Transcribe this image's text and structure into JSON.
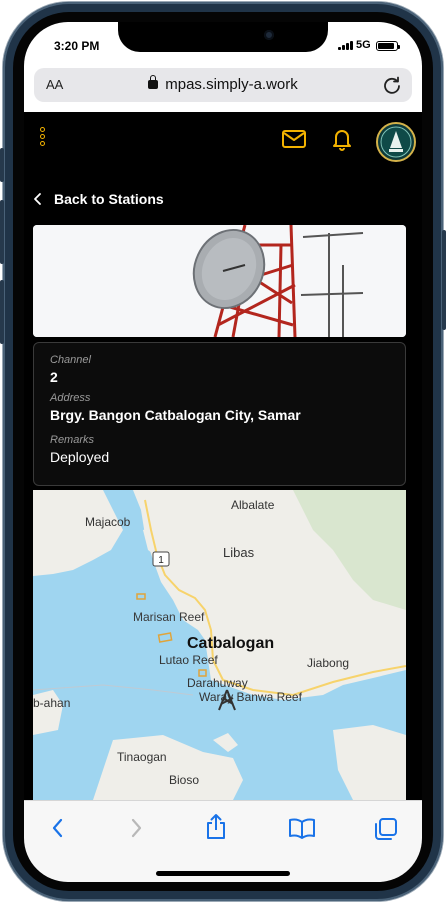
{
  "status_bar": {
    "time": "3:20 PM",
    "network": "5G",
    "battery_level": 0.9
  },
  "browser": {
    "text_size_label": "AA",
    "url": "mpas.simply-a.work",
    "reload_icon": "reload-icon",
    "toolbar": [
      "back-icon",
      "forward-icon",
      "share-icon",
      "bookmarks-icon",
      "tabs-icon"
    ]
  },
  "app_header": {
    "menu_icon": "kebab-menu-icon",
    "mail_icon": "mail-icon",
    "bell_icon": "bell-icon",
    "accent_color": "#f2b200"
  },
  "nav": {
    "back_label": "Back to Stations"
  },
  "station": {
    "channel_label": "Channel",
    "channel_value": "2",
    "address_label": "Address",
    "address_value": "Brgy. Bangon Catbalogan City, Samar",
    "remarks_label": "Remarks",
    "remarks_value": "Deployed"
  },
  "map": {
    "labels": {
      "albalate": "Albalate",
      "majacob": "Majacob",
      "libas": "Libas",
      "road_number": "1",
      "marisan_reef": "Marisan Reef",
      "catbalogan": "Catbalogan",
      "lutao_reef": "Lutao Reef",
      "jiabong": "Jiabong",
      "darahuway": "Darahuway",
      "waray_banwa_reef": "Waray Banwa Reef",
      "b_ahan": "b-ahan",
      "tinaogan": "Tinaogan",
      "bioso": "Bioso"
    },
    "marker_icon": "tower-marker-icon"
  }
}
